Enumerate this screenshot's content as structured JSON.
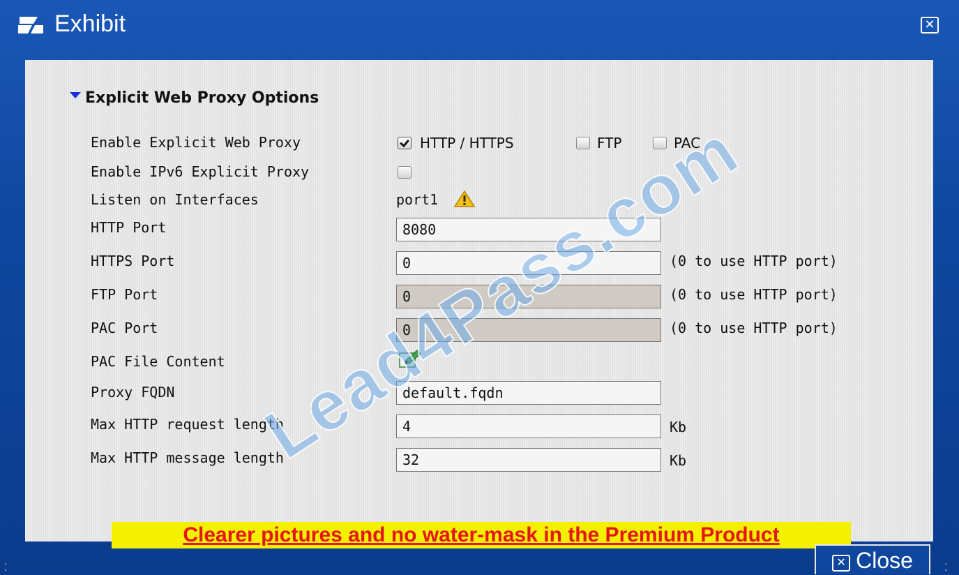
{
  "window": {
    "title": "Exhibit",
    "close_label": "Close"
  },
  "section": {
    "title": "Explicit Web Proxy Options"
  },
  "rows": {
    "enable_explicit_web_proxy": {
      "label": "Enable Explicit Web Proxy",
      "options": {
        "http_https": {
          "label": "HTTP / HTTPS",
          "checked": true
        },
        "ftp": {
          "label": "FTP",
          "checked": false
        },
        "pac": {
          "label": "PAC",
          "checked": false
        }
      }
    },
    "enable_ipv6": {
      "label": "Enable IPv6 Explicit Proxy",
      "checked": false
    },
    "listen_on_interfaces": {
      "label": "Listen on Interfaces",
      "value": "port1"
    },
    "http_port": {
      "label": "HTTP Port",
      "value": "8080"
    },
    "https_port": {
      "label": "HTTPS Port",
      "value": "0",
      "hint": "(0 to use HTTP port)"
    },
    "ftp_port": {
      "label": "FTP Port",
      "value": "0",
      "hint": "(0 to use HTTP port)"
    },
    "pac_port": {
      "label": "PAC Port",
      "value": "0",
      "hint": "(0 to use HTTP port)"
    },
    "pac_file_content": {
      "label": "PAC File Content"
    },
    "proxy_fqdn": {
      "label": "Proxy FQDN",
      "value": "default.fqdn"
    },
    "max_request_length": {
      "label": "Max HTTP request length",
      "value": "4",
      "unit": "Kb"
    },
    "max_message_length": {
      "label": "Max HTTP message length",
      "value": "32",
      "unit": "Kb"
    }
  },
  "overlay": {
    "watermark": "Lead4Pass.com",
    "promo": "Clearer pictures and no water-mask in the Premium Product"
  },
  "icons": {
    "title": "exhibit-icon",
    "warning": "warning-icon",
    "edit": "edit-icon"
  },
  "colors": {
    "titlebar": "#1a57b6",
    "promo_bg": "#f5f000",
    "promo_text": "#e5161a"
  }
}
